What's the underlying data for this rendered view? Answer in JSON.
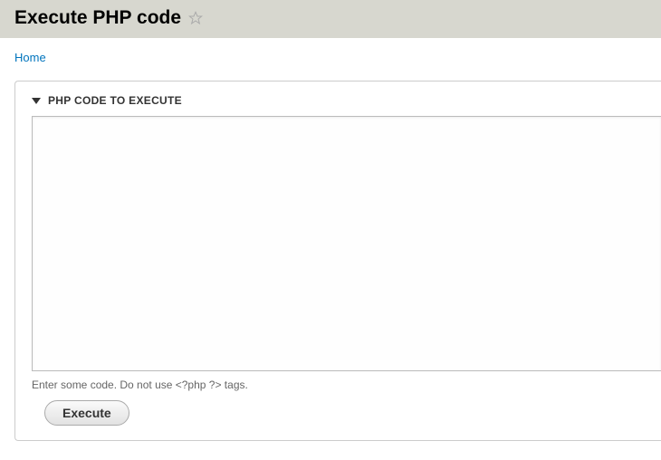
{
  "header": {
    "title": "Execute PHP code"
  },
  "breadcrumb": {
    "home": "Home"
  },
  "fieldset": {
    "legend": "PHP CODE TO EXECUTE",
    "textarea_value": "",
    "help_text": "Enter some code. Do not use <?php  ?> tags.",
    "submit_label": "Execute"
  }
}
